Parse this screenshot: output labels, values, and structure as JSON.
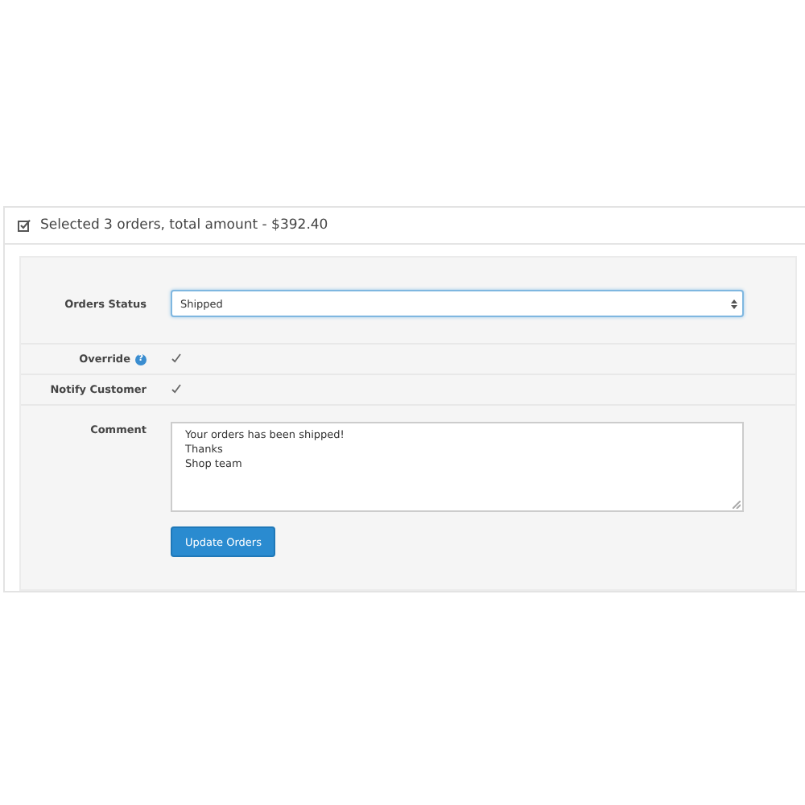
{
  "panel": {
    "title": "Selected 3 orders, total amount - $392.40"
  },
  "form": {
    "status": {
      "label": "Orders Status",
      "value": "Shipped"
    },
    "override": {
      "label": "Override",
      "help": "?",
      "checked": true
    },
    "notify": {
      "label": "Notify Customer",
      "checked": true
    },
    "comment": {
      "label": "Comment",
      "value": "Your orders has been shipped!\nThanks\nShop team"
    },
    "submit": "Update Orders"
  }
}
